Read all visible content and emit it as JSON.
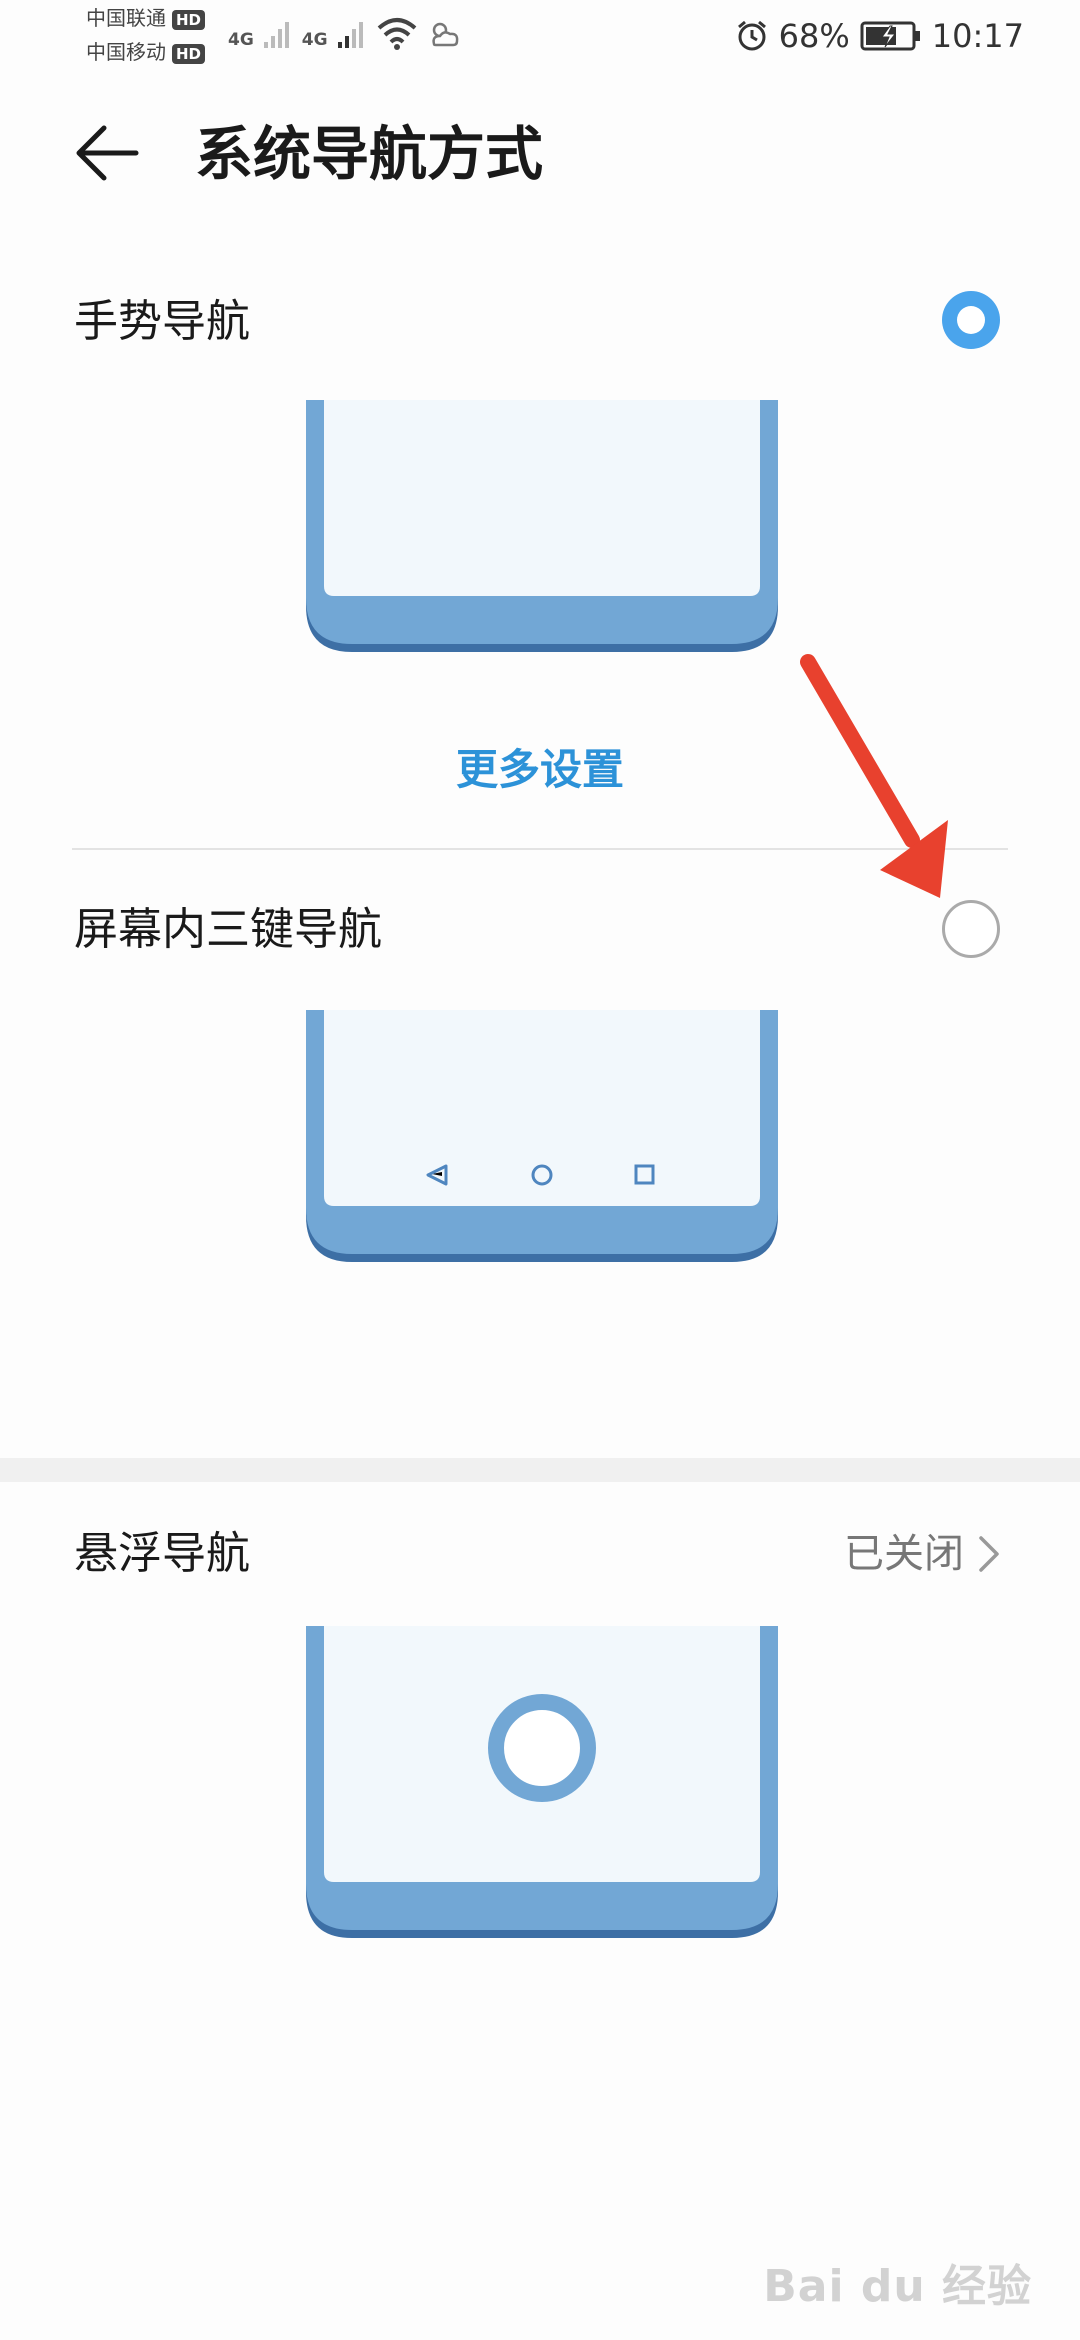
{
  "status_bar": {
    "carrier1": "中国联通",
    "carrier2": "中国移动",
    "hd_badge": "HD",
    "net1": "4G",
    "net2": "4G",
    "battery": "68%",
    "time": "10:17"
  },
  "header": {
    "title": "系统导航方式",
    "back_icon": "arrow-left-icon"
  },
  "options": [
    {
      "label": "手势导航",
      "selected": true
    },
    {
      "label": "屏幕内三键导航",
      "selected": false
    }
  ],
  "more_settings": "更多设置",
  "floating_nav": {
    "label": "悬浮导航",
    "status": "已关闭"
  },
  "watermark": "Bai du 经验",
  "colors": {
    "accent": "#4aa4ec",
    "link": "#2c92d8",
    "phone_frame": "#72a7d5",
    "annotation_arrow": "#e8412e"
  }
}
